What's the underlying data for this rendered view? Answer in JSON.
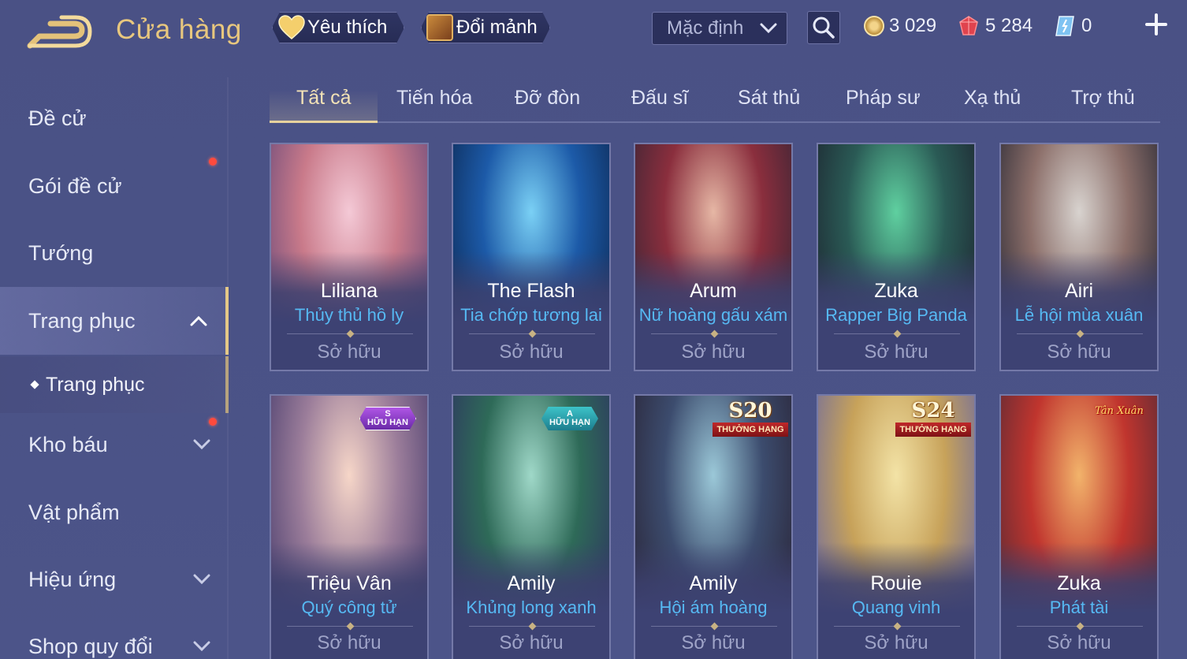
{
  "header": {
    "title": "Cửa hàng",
    "favorites_label": "Yêu thích",
    "exchange_label": "Đổi mảnh",
    "sort_value": "Mặc định",
    "currency": {
      "coins": "3 029",
      "gems": "5 284",
      "vouchers": "0"
    }
  },
  "sidebar": {
    "items": [
      {
        "label": "Đề cử"
      },
      {
        "label": "Gói đề cử"
      },
      {
        "label": "Tướng"
      },
      {
        "label": "Trang phục"
      },
      {
        "label": "Trang phục"
      },
      {
        "label": "Kho báu"
      },
      {
        "label": "Vật phẩm"
      },
      {
        "label": "Hiệu ứng"
      },
      {
        "label": "Shop quy đổi"
      }
    ]
  },
  "tabs": [
    {
      "label": "Tất cả"
    },
    {
      "label": "Tiến hóa"
    },
    {
      "label": "Đỡ đòn"
    },
    {
      "label": "Đấu sĩ"
    },
    {
      "label": "Sát thủ"
    },
    {
      "label": "Pháp sư"
    },
    {
      "label": "Xạ thủ"
    },
    {
      "label": "Trợ thủ"
    }
  ],
  "cards": [
    {
      "hero": "Liliana",
      "skin": "Thủy thủ hồ ly",
      "status": "Sở hữu",
      "art_colors": [
        "#f4c9d6",
        "#c97a8a",
        "#6d4b7a"
      ]
    },
    {
      "hero": "The Flash",
      "skin": "Tia chớp tương lai",
      "status": "Sở hữu",
      "art_colors": [
        "#7ad0f5",
        "#1c5aa8",
        "#0d2a55"
      ]
    },
    {
      "hero": "Arum",
      "skin": "Nữ hoàng gấu xám",
      "status": "Sở hữu",
      "art_colors": [
        "#e6b7a5",
        "#8a2e3d",
        "#3a2535"
      ]
    },
    {
      "hero": "Zuka",
      "skin": "Rapper Big Panda",
      "status": "Sở hữu",
      "art_colors": [
        "#5fd0a0",
        "#2a5a55",
        "#1d2530"
      ]
    },
    {
      "hero": "Airi",
      "skin": "Lễ hội mùa xuân",
      "status": "Sở hữu",
      "art_colors": [
        "#d8d3cf",
        "#8c6f6a",
        "#2b2a35"
      ]
    },
    {
      "hero": "Triệu Vân",
      "skin": "Quý công tử",
      "status": "Sở hữu",
      "badge": {
        "top": "S",
        "bottom": "HỮU HẠN",
        "style": "purple"
      },
      "art_colors": [
        "#f6d6c8",
        "#9b7d9a",
        "#4a3e6e"
      ]
    },
    {
      "hero": "Amily",
      "skin": "Khủng long xanh",
      "status": "Sở hữu",
      "badge": {
        "top": "A",
        "bottom": "HỮU HẠN",
        "style": "teal"
      },
      "art_colors": [
        "#9fd8c8",
        "#2e6a58",
        "#2d3560"
      ]
    },
    {
      "hero": "Amily",
      "skin": "Hội ám hoàng",
      "status": "Sở hữu",
      "season": {
        "number": "S20",
        "label": "THƯỞNG HẠNG"
      },
      "art_colors": [
        "#9bc8d8",
        "#3c4c6e",
        "#2a2538"
      ]
    },
    {
      "hero": "Rouie",
      "skin": "Quang vinh",
      "status": "Sở hữu",
      "season": {
        "number": "S24",
        "label": "THƯỞNG HẠNG"
      },
      "art_colors": [
        "#f3e3a6",
        "#c7a25a",
        "#6d6aa0"
      ]
    },
    {
      "hero": "Zuka",
      "skin": "Phát tài",
      "status": "Sở hữu",
      "tet_label": "Tân Xuân",
      "art_colors": [
        "#f2b36b",
        "#c0352e",
        "#5a2a35"
      ]
    }
  ],
  "colors": {
    "accent_gold": "#e8c77e",
    "skin_name_blue": "#56b9f3",
    "notification_red": "#ff4a3d",
    "background": "#4a5185"
  },
  "icons": [
    "back-arrow-icon",
    "heart-icon",
    "treasure-box-icon",
    "chevron-down-icon",
    "search-icon",
    "coin-icon",
    "gem-icon",
    "voucher-icon",
    "plus-icon"
  ]
}
